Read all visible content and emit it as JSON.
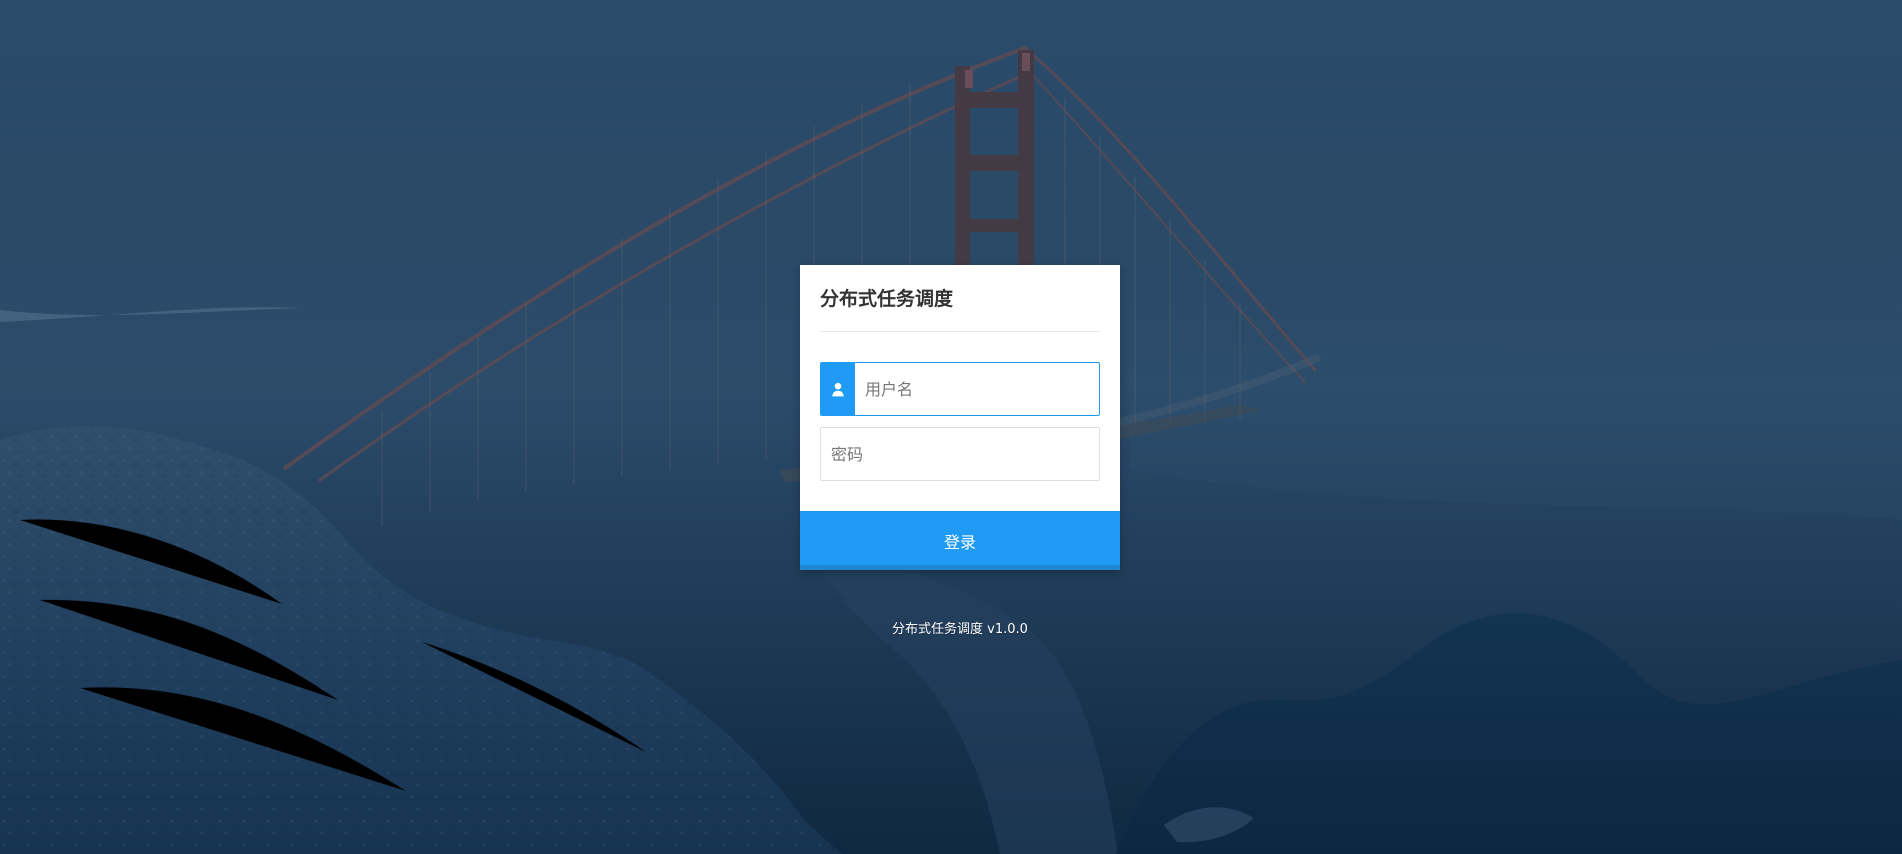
{
  "app": {
    "title": "分布式任务调度",
    "version_text": "分布式任务调度 v1.0.0"
  },
  "login": {
    "username_placeholder": "用户名",
    "password_placeholder": "密码",
    "submit_label": "登录"
  },
  "icons": {
    "user_icon": "user-icon"
  },
  "colors": {
    "accent": "#209bf5",
    "background_tint": "#1f3e5d",
    "card_background": "#ffffff",
    "title_text": "#333333"
  }
}
